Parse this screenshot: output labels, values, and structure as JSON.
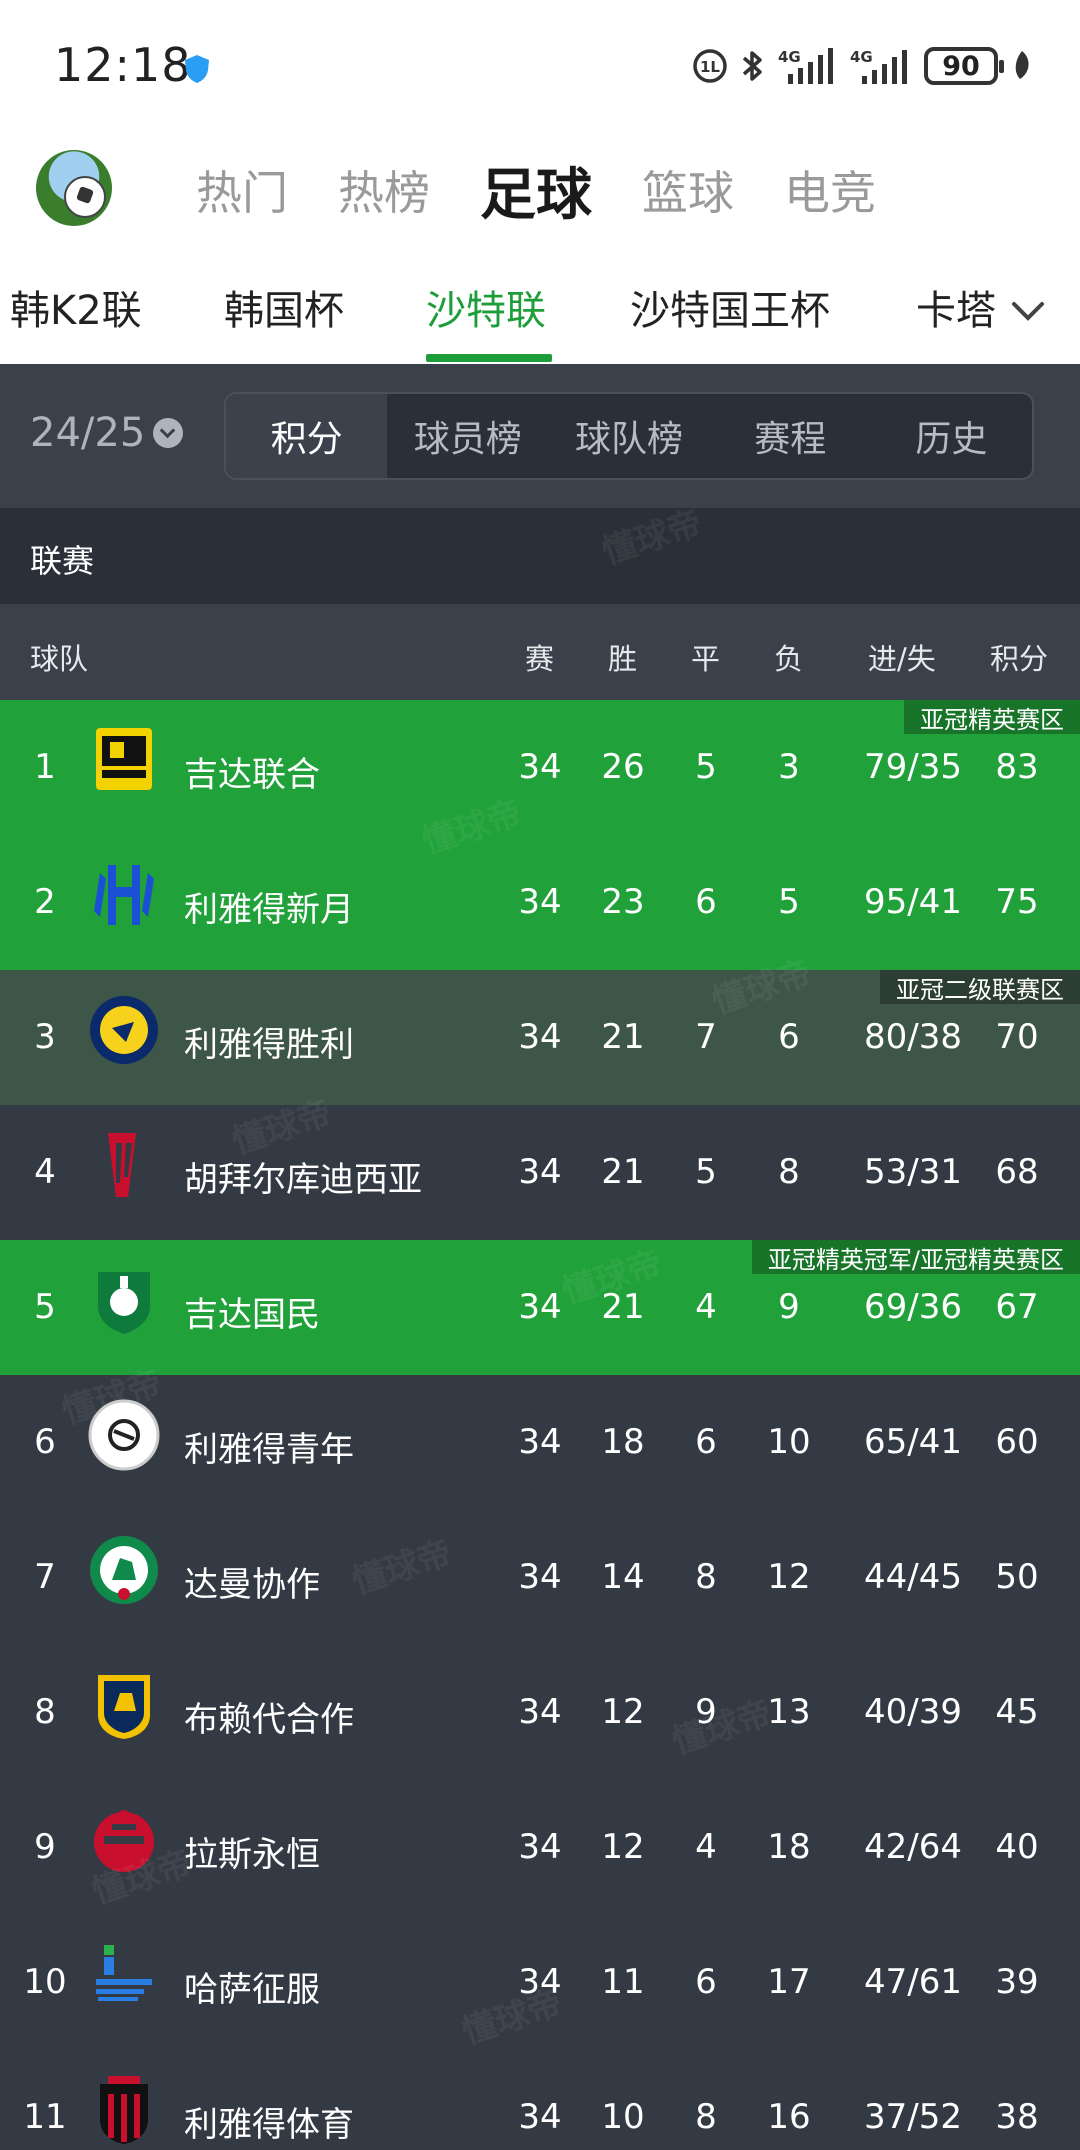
{
  "status": {
    "time": "12:18",
    "battery": "90"
  },
  "main_tabs": [
    "热门",
    "热榜",
    "足球",
    "篮球",
    "电竞"
  ],
  "main_tab_active": 2,
  "sub_tabs": [
    "韩K2联",
    "韩国杯",
    "沙特联",
    "沙特国王杯",
    "卡塔"
  ],
  "sub_tab_active": 2,
  "season": "24/25",
  "segments": [
    "积分",
    "球员榜",
    "球队榜",
    "赛程",
    "历史"
  ],
  "segment_active": 0,
  "section_label": "联赛",
  "columns": {
    "team": "球队",
    "played": "赛",
    "won": "胜",
    "draw": "平",
    "lost": "负",
    "goals": "进/失",
    "points": "积分"
  },
  "zones": {
    "acl_elite": "亚冠精英赛区",
    "acl_two": "亚冠二级联赛区",
    "acl_champion": "亚冠精英冠军/亚冠精英赛区"
  },
  "colors": {
    "zone_elite": "#21a13a",
    "zone_two": "#3e5648",
    "row_default": "#343a44",
    "accent": "#1e9e3a"
  },
  "watermark_text": "懂球帝",
  "rows": [
    {
      "rank": "1",
      "team": "吉达联合",
      "p": "34",
      "w": "26",
      "d": "5",
      "l": "3",
      "g": "79/35",
      "pts": "83",
      "zone": "elite",
      "tag": "亚冠精英赛区",
      "badge": "ittihad"
    },
    {
      "rank": "2",
      "team": "利雅得新月",
      "p": "34",
      "w": "23",
      "d": "6",
      "l": "5",
      "g": "95/41",
      "pts": "75",
      "zone": "elite",
      "tag": "",
      "badge": "hilal"
    },
    {
      "rank": "3",
      "team": "利雅得胜利",
      "p": "34",
      "w": "21",
      "d": "7",
      "l": "6",
      "g": "80/38",
      "pts": "70",
      "zone": "two",
      "tag": "亚冠二级联赛区",
      "badge": "nassr"
    },
    {
      "rank": "4",
      "team": "胡拜尔库迪西亚",
      "p": "34",
      "w": "21",
      "d": "5",
      "l": "8",
      "g": "53/31",
      "pts": "68",
      "zone": "none",
      "tag": "",
      "badge": "qadsiah"
    },
    {
      "rank": "5",
      "team": "吉达国民",
      "p": "34",
      "w": "21",
      "d": "4",
      "l": "9",
      "g": "69/36",
      "pts": "67",
      "zone": "elite",
      "tag": "亚冠精英冠军/亚冠精英赛区",
      "badge": "ahli"
    },
    {
      "rank": "6",
      "team": "利雅得青年",
      "p": "34",
      "w": "18",
      "d": "6",
      "l": "10",
      "g": "65/41",
      "pts": "60",
      "zone": "none",
      "tag": "",
      "badge": "shabab"
    },
    {
      "rank": "7",
      "team": "达曼协作",
      "p": "34",
      "w": "14",
      "d": "8",
      "l": "12",
      "g": "44/45",
      "pts": "50",
      "zone": "none",
      "tag": "",
      "badge": "ettifaq"
    },
    {
      "rank": "8",
      "team": "布赖代合作",
      "p": "34",
      "w": "12",
      "d": "9",
      "l": "13",
      "g": "40/39",
      "pts": "45",
      "zone": "none",
      "tag": "",
      "badge": "taawoun"
    },
    {
      "rank": "9",
      "team": "拉斯永恒",
      "p": "34",
      "w": "12",
      "d": "4",
      "l": "18",
      "g": "42/64",
      "pts": "40",
      "zone": "none",
      "tag": "",
      "badge": "raed"
    },
    {
      "rank": "10",
      "team": "哈萨征服",
      "p": "34",
      "w": "11",
      "d": "6",
      "l": "17",
      "g": "47/61",
      "pts": "39",
      "zone": "none",
      "tag": "",
      "badge": "fateh"
    },
    {
      "rank": "11",
      "team": "利雅得体育",
      "p": "34",
      "w": "10",
      "d": "8",
      "l": "16",
      "g": "37/52",
      "pts": "38",
      "zone": "none",
      "tag": "",
      "badge": "riyadh"
    }
  ]
}
